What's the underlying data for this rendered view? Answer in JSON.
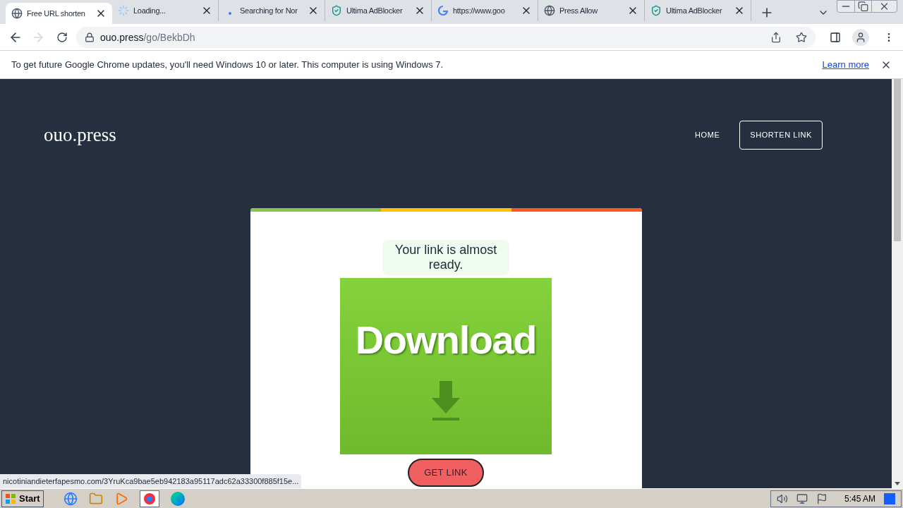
{
  "tabs": [
    {
      "title": "Free URL shorten",
      "kind": "site",
      "selected": true
    },
    {
      "title": "Loading...",
      "kind": "loading",
      "selected": false
    },
    {
      "title": "Searching for Nor",
      "kind": "waiting",
      "selected": false
    },
    {
      "title": "Ultima AdBlocker",
      "kind": "extension",
      "selected": false
    },
    {
      "title": "https://www.goo",
      "kind": "search",
      "selected": false
    },
    {
      "title": "Press Allow",
      "kind": "site",
      "selected": false
    },
    {
      "title": "Ultima AdBlocker",
      "kind": "extension",
      "selected": false
    }
  ],
  "address": {
    "host": "ouo.press",
    "path": "/go/BekbDh"
  },
  "infobar": {
    "message": "To get future Google Chrome updates, you'll need Windows 10 or later. This computer is using Windows 7.",
    "link": "Learn more"
  },
  "site": {
    "logo": "ouo.press",
    "nav": [
      {
        "label": "HOME",
        "kind": "plain"
      },
      {
        "label": "SHORTEN LINK",
        "kind": "outlined"
      }
    ]
  },
  "card": {
    "stripe": [
      {
        "color": "#8bc34a"
      },
      {
        "color": "#ffc107"
      },
      {
        "color": "#ff5722"
      }
    ],
    "headline": "Your link is almost ready.",
    "banner": "Download",
    "button": "GET LINK"
  },
  "status_url": "nicotiniandieterfapesmo.com/3YruKca9bae5eb942183a95117adc62a33300f885f15e...",
  "taskbar": {
    "start": "Start",
    "clock": "5:45 AM"
  }
}
